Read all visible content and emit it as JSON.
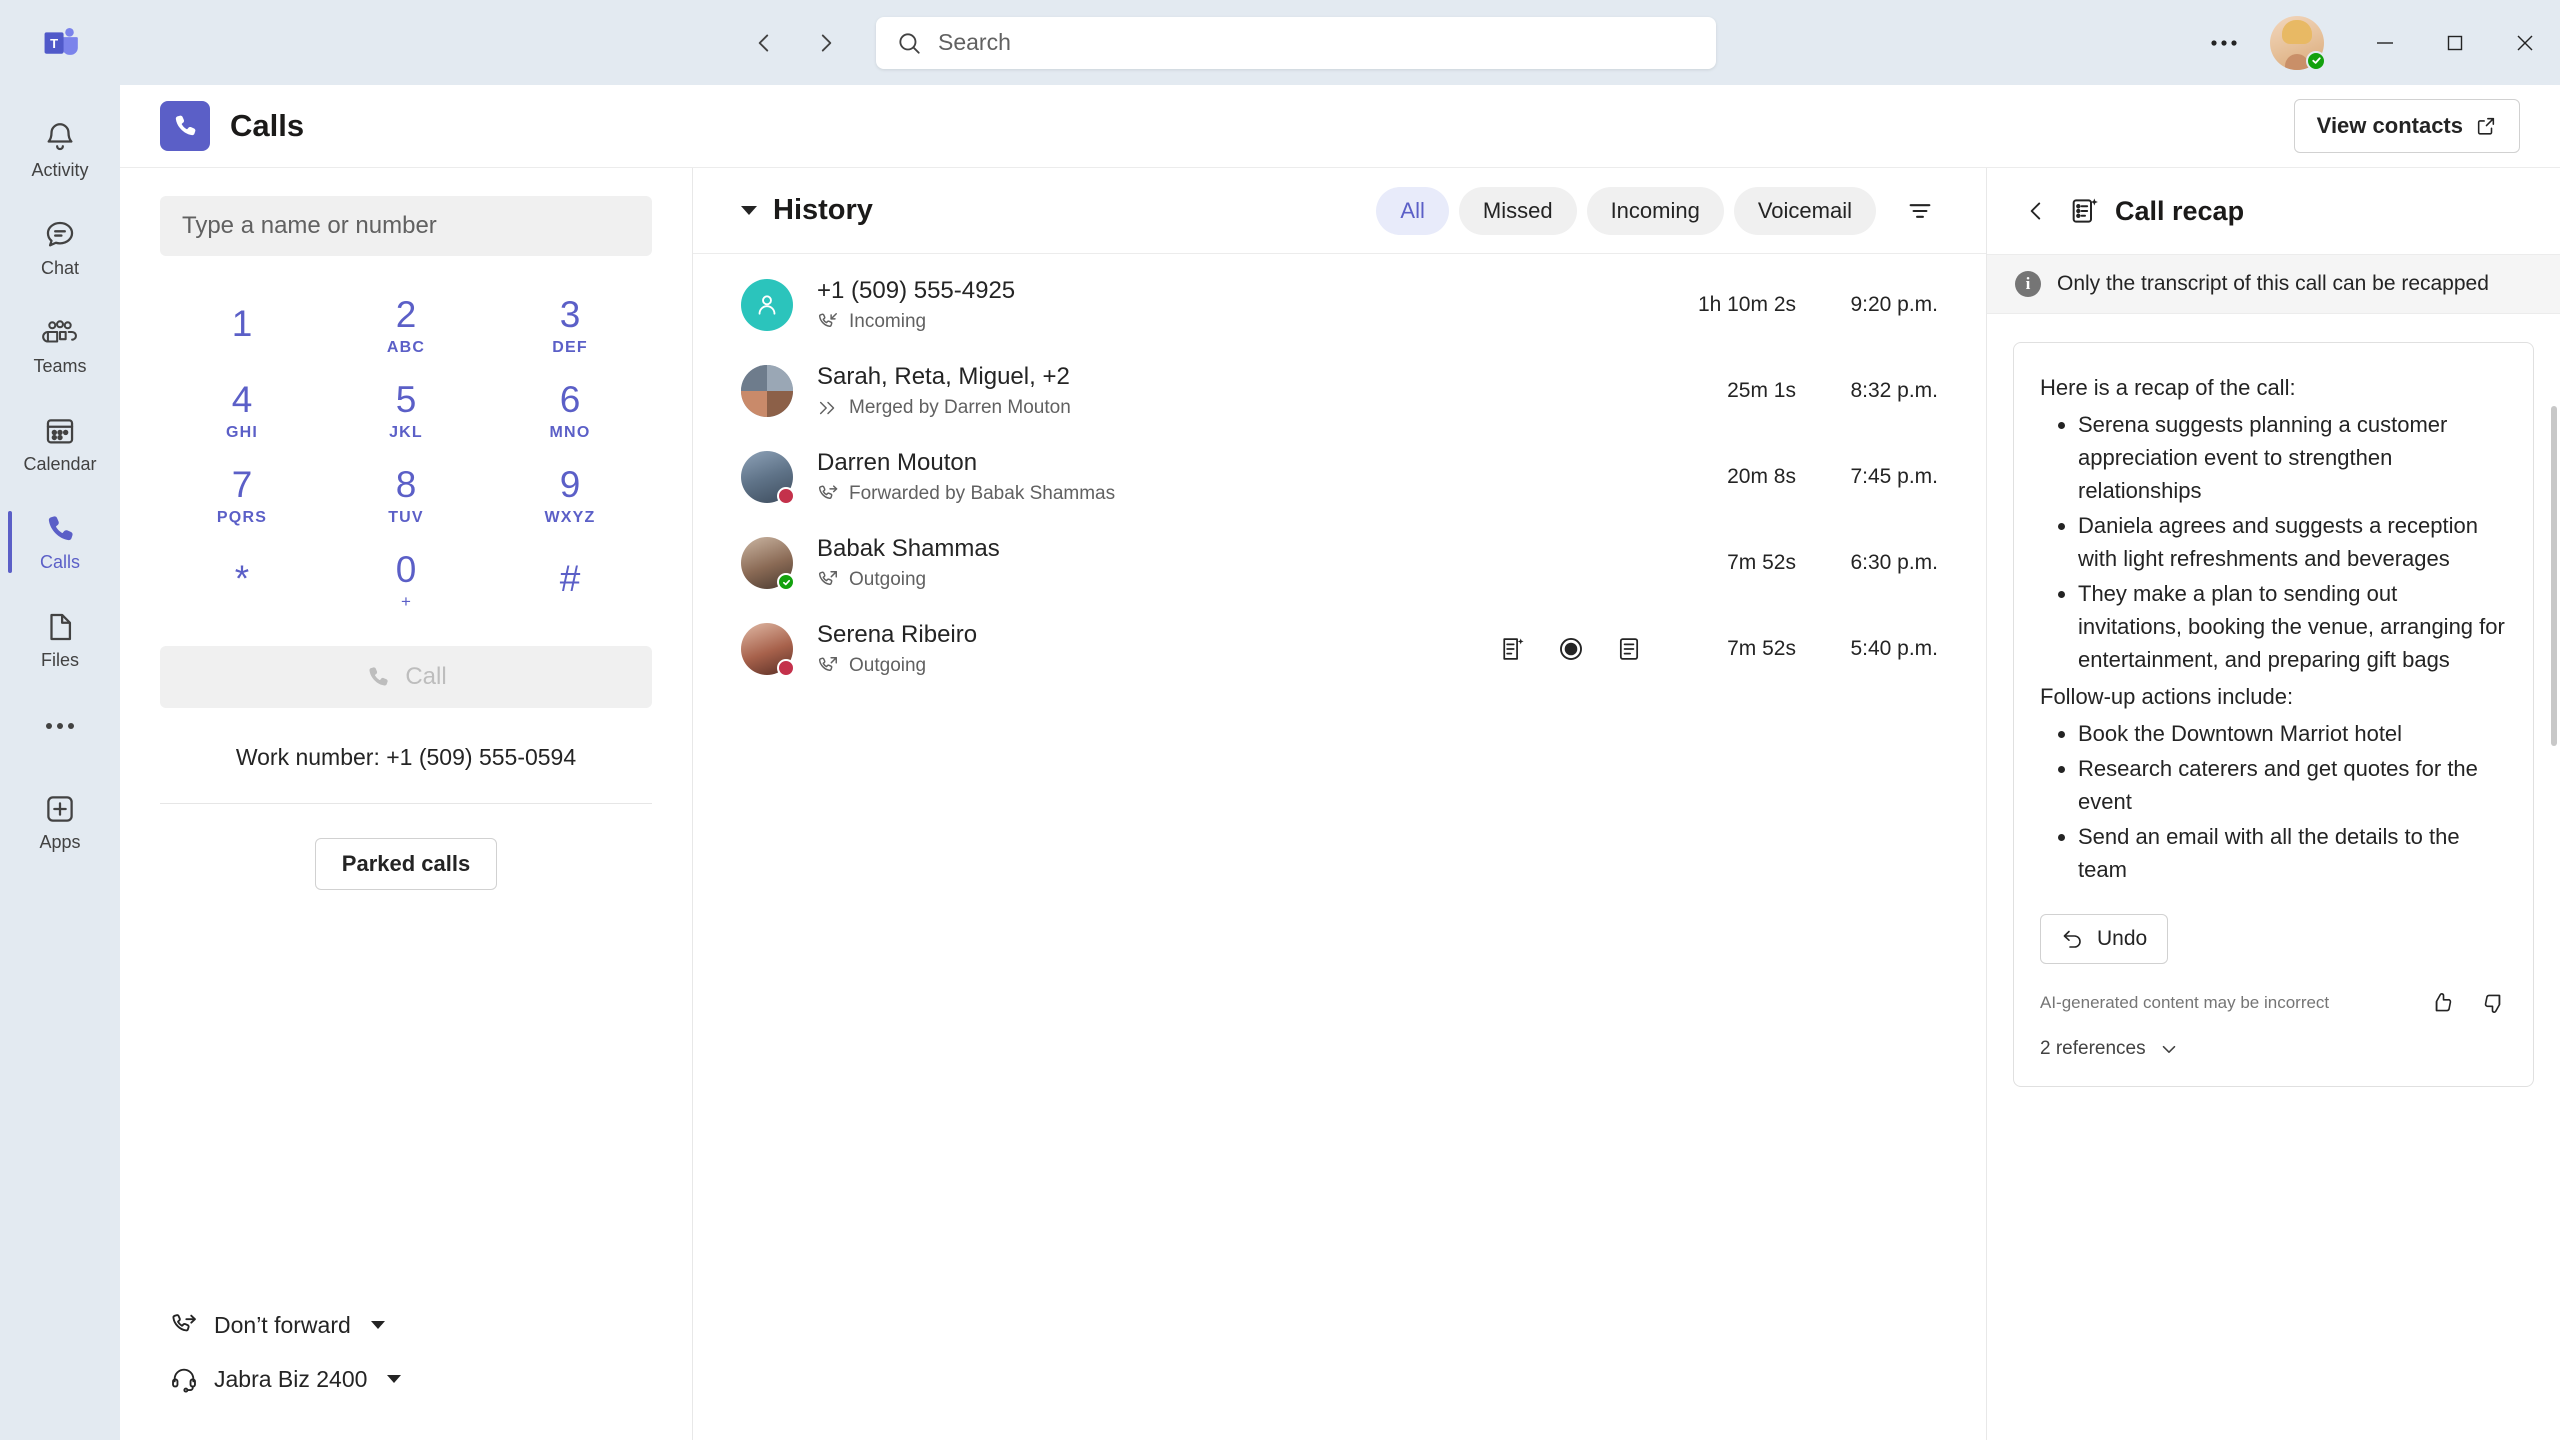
{
  "titlebar": {
    "logo_name": "microsoft-teams-logo",
    "back_label": "Back",
    "forward_label": "Forward",
    "search": {
      "placeholder": "Search",
      "value": ""
    },
    "more_label": "…",
    "user_presence": "Available",
    "minimize_label": "Minimize",
    "maximize_label": "Maximize",
    "close_label": "Close"
  },
  "rail": {
    "items": [
      {
        "label": "Activity",
        "icon": "bell-icon",
        "active": false
      },
      {
        "label": "Chat",
        "icon": "chat-icon",
        "active": false
      },
      {
        "label": "Teams",
        "icon": "teams-icon",
        "active": false
      },
      {
        "label": "Calendar",
        "icon": "calendar-icon",
        "active": false
      },
      {
        "label": "Calls",
        "icon": "phone-icon",
        "active": true
      },
      {
        "label": "Files",
        "icon": "file-icon",
        "active": false
      }
    ],
    "more_label": "…",
    "apps_label": "Apps"
  },
  "header": {
    "title": "Calls",
    "view_contacts_label": "View contacts"
  },
  "dialpad": {
    "input_placeholder": "Type a name or number",
    "input_value": "",
    "keys": [
      {
        "digit": "1",
        "sub": ""
      },
      {
        "digit": "2",
        "sub": "ABC"
      },
      {
        "digit": "3",
        "sub": "DEF"
      },
      {
        "digit": "4",
        "sub": "GHI"
      },
      {
        "digit": "5",
        "sub": "JKL"
      },
      {
        "digit": "6",
        "sub": "MNO"
      },
      {
        "digit": "7",
        "sub": "PQRS"
      },
      {
        "digit": "8",
        "sub": "TUV"
      },
      {
        "digit": "9",
        "sub": "WXYZ"
      },
      {
        "digit": "*",
        "sub": ""
      },
      {
        "digit": "0",
        "sub": "+"
      },
      {
        "digit": "#",
        "sub": ""
      }
    ],
    "call_label": "Call",
    "work_number": "Work number: +1 (509) 555-0594",
    "parked_calls_label": "Parked calls",
    "forward_label": "Don’t forward",
    "device_label": "Jabra Biz 2400"
  },
  "history": {
    "title": "History",
    "filters": [
      {
        "label": "All",
        "active": true
      },
      {
        "label": "Missed",
        "active": false
      },
      {
        "label": "Incoming",
        "active": false
      },
      {
        "label": "Voicemail",
        "active": false
      }
    ],
    "filter_icon": "filter-icon",
    "rows": [
      {
        "name": "+1 (509) 555-4925",
        "sub": "Incoming",
        "sub_icon": "call-incoming-icon",
        "duration": "1h 10m 2s",
        "time": "9:20 p.m.",
        "avatar_type": "generic",
        "avatar_color": "#2bc4bc",
        "presence": "",
        "actions": []
      },
      {
        "name": "Sarah, Reta, Miguel, +2",
        "sub": "Merged by Darren Mouton",
        "sub_icon": "call-merged-icon",
        "duration": "25m 1s",
        "time": "8:32 p.m.",
        "avatar_type": "group",
        "avatar_color": "#c4663a",
        "presence": "",
        "actions": []
      },
      {
        "name": "Darren Mouton",
        "sub": "Forwarded by Babak Shammas",
        "sub_icon": "call-forward-icon",
        "duration": "20m 8s",
        "time": "7:45 p.m.",
        "avatar_type": "photo",
        "avatar_color": "#6b7f99",
        "presence": "busy",
        "actions": []
      },
      {
        "name": "Babak Shammas",
        "sub": "Outgoing",
        "sub_icon": "call-outgoing-icon",
        "duration": "7m 52s",
        "time": "6:30 p.m.",
        "avatar_type": "photo",
        "avatar_color": "#8a6a55",
        "presence": "available",
        "actions": []
      },
      {
        "name": "Serena Ribeiro",
        "sub": "Outgoing",
        "sub_icon": "call-outgoing-icon",
        "duration": "7m 52s",
        "time": "5:40 p.m.",
        "avatar_type": "photo",
        "avatar_color": "#9c5b4a",
        "presence": "busy",
        "actions": [
          "call-recap-icon",
          "recording-icon",
          "transcript-icon"
        ]
      }
    ]
  },
  "recap": {
    "title": "Call recap",
    "back_label": "Back",
    "info_text": "Only the transcript of this call can be recapped",
    "lead": "Here is a recap of the call:",
    "bullets": [
      "Serena suggests planning a customer appreciation event to strengthen relationships",
      "Daniela agrees and suggests a reception with light refreshments and beverages",
      "They make a plan to sending out invitations, booking the venue, arranging for entertainment, and preparing gift bags"
    ],
    "followup_lead": "Follow-up actions include:",
    "followup_bullets": [
      "Book the Downtown Marriot hotel",
      "Research caterers and get quotes for the event",
      "Send an email with all the details to the team"
    ],
    "undo_label": "Undo",
    "ai_note": "AI-generated content may be incorrect",
    "references_label": "2 references"
  },
  "colors": {
    "accent": "#5b5fc7",
    "titlebar_bg": "#e3eaf1",
    "pill_active_bg": "#e8ebfa",
    "available": "#13a10e",
    "busy": "#c4314b"
  }
}
